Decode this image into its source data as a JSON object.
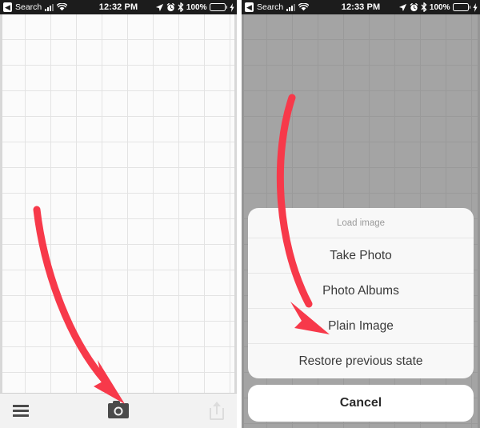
{
  "panels": [
    {
      "id": "left",
      "statusbar": {
        "back_label": "Search",
        "back_icon": "chevron-left-icon",
        "signal_icon": "cellular-signal-icon",
        "wifi_icon": "wifi-icon",
        "time": "12:32 PM",
        "location_icon": "location-arrow-icon",
        "alarm_icon": "alarm-clock-icon",
        "bluetooth_icon": "bluetooth-icon",
        "battery_percent": "100%",
        "battery_icon": "battery-full-icon",
        "charging_icon": "lightning-bolt-icon",
        "battery_color": "#34d03c"
      },
      "toolbar": {
        "menu_icon": "hamburger-menu-icon",
        "camera_icon": "camera-icon",
        "share_icon": "share-upload-icon"
      },
      "annotation": {
        "arrow_color": "#f7394a",
        "points_at": "camera-icon"
      }
    },
    {
      "id": "right",
      "statusbar": {
        "back_label": "Search",
        "back_icon": "chevron-left-icon",
        "signal_icon": "cellular-signal-icon",
        "wifi_icon": "wifi-icon",
        "time": "12:33 PM",
        "location_icon": "location-arrow-icon",
        "alarm_icon": "alarm-clock-icon",
        "bluetooth_icon": "bluetooth-icon",
        "battery_percent": "100%",
        "battery_icon": "battery-full-icon",
        "charging_icon": "lightning-bolt-icon",
        "battery_color": "#34d03c"
      },
      "action_sheet": {
        "title": "Load image",
        "options": [
          "Take Photo",
          "Photo Albums",
          "Plain Image",
          "Restore previous state"
        ],
        "cancel_label": "Cancel"
      },
      "annotation": {
        "arrow_color": "#f7394a",
        "points_at": "Plain Image"
      }
    }
  ]
}
